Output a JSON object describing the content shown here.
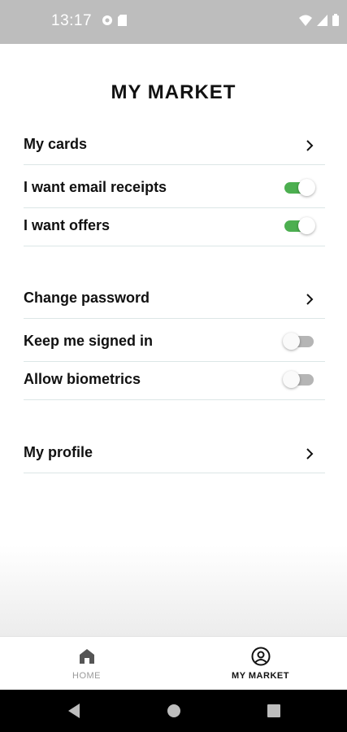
{
  "status_bar": {
    "time": "13:17"
  },
  "page": {
    "title": "MY MARKET"
  },
  "settings": {
    "my_cards": "My cards",
    "email_receipts": {
      "label": "I want email receipts",
      "on": true
    },
    "offers": {
      "label": "I want offers",
      "on": true
    },
    "change_password": "Change password",
    "keep_signed_in": {
      "label": "Keep me signed in",
      "on": false
    },
    "biometrics": {
      "label": "Allow biometrics",
      "on": false
    },
    "my_profile": "My profile"
  },
  "bottom_nav": {
    "home": "HOME",
    "my_market": "MY MARKET",
    "active": "my_market"
  },
  "colors": {
    "toggle_on": "#4caf50",
    "toggle_off": "#b5b5b5",
    "status_bar": "#bdbdbd"
  },
  "icons": [
    "wifi-icon",
    "signal-icon",
    "battery-icon",
    "chevron-right-icon",
    "home-icon",
    "user-circle-icon",
    "back-icon",
    "home-circle-icon",
    "recents-icon"
  ]
}
